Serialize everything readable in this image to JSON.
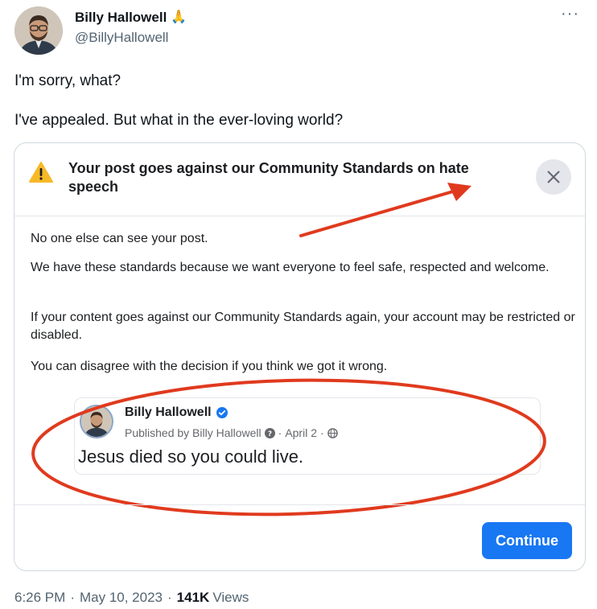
{
  "author": {
    "name": "Billy Hallowell",
    "emoji": "🙏",
    "handle": "@BillyHallowell"
  },
  "menu": {
    "more_label": "···"
  },
  "tweet": {
    "line1": "I'm sorry, what?",
    "line2": "I've appealed. But what in the ever-loving world?"
  },
  "notice": {
    "title": "Your post goes against our Community Standards on hate speech",
    "close_symbol": "✕",
    "paragraphs": [
      "No one else can see your post.",
      "We have these standards because we want everyone to feel safe, respected and welcome.",
      "If your content goes against our Community Standards again, your account may be restricted or disabled.",
      "You can disagree with the decision if you think we got it wrong."
    ],
    "continue_label": "Continue"
  },
  "post": {
    "author": "Billy Hallowell",
    "published_by": "Published by Billy Hallowell",
    "date": "April 2",
    "separator": "·",
    "text": "Jesus died so you could live."
  },
  "footer": {
    "time": "6:26 PM",
    "date": "May 10, 2023",
    "separator": "·",
    "views_count": "141K",
    "views_label": "Views"
  },
  "colors": {
    "facebook_blue": "#1877f2",
    "warning_yellow": "#f7b928",
    "annotation_red": "#e03a1e",
    "muted_text": "#536471"
  }
}
